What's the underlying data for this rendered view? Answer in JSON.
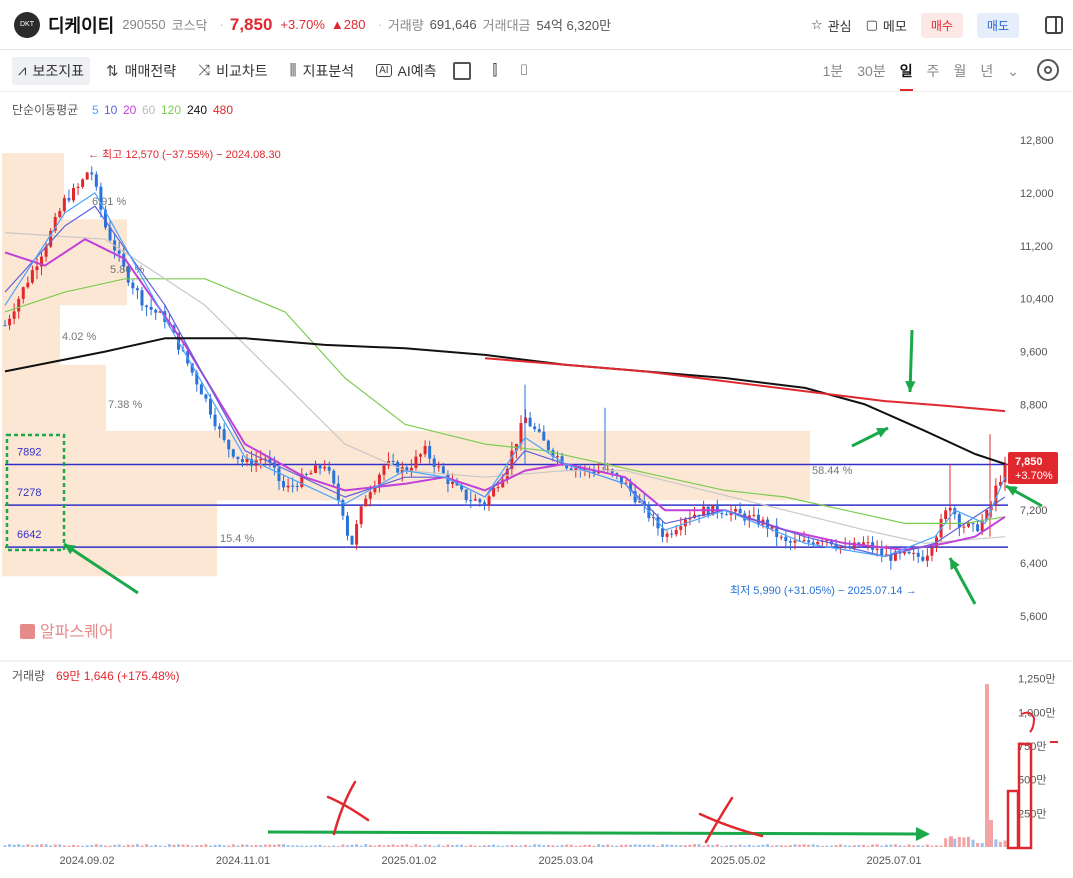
{
  "header": {
    "logo_text": "DKT",
    "name": "디케이티",
    "code": "290550",
    "market": "코스닥",
    "price": "7,850",
    "change_pct": "+3.70%",
    "change": "▲280",
    "volume_label": "거래량",
    "volume": "691,646",
    "amount_label": "거래대금",
    "amount": "54억 6,320만",
    "watch_label": "관심",
    "memo_label": "메모",
    "buy_label": "매수",
    "sell_label": "매도"
  },
  "toolbar": {
    "indicators": "보조지표",
    "strategy": "매매전략",
    "compare": "비교차트",
    "analysis": "지표분석",
    "ai_badge": "AI",
    "ai": "AI예측",
    "periods": [
      "1분",
      "30분",
      "일",
      "주",
      "월",
      "년"
    ],
    "selected_period": "일"
  },
  "chart_data": {
    "type": "candlestick",
    "ma_legend": {
      "label": "단순이동평균",
      "periods": [
        "5",
        "10",
        "20",
        "60",
        "120",
        "240",
        "480"
      ],
      "colors": [
        "#4aa3ff",
        "#6060d8",
        "#c040d8",
        "#bbbbbb",
        "#7ccc50",
        "#111111",
        "#e0282e"
      ]
    },
    "y_ticks": [
      12800,
      12000,
      11200,
      10400,
      9600,
      8800,
      7200,
      6400,
      5600
    ],
    "y_tick_labels": [
      "12,800",
      "12,000",
      "11,200",
      "10,400",
      "9,600",
      "8,800",
      "7,200",
      "6,400",
      "5,600"
    ],
    "y_range": [
      5300,
      13500
    ],
    "x_date_labels": [
      "2024.09.02",
      "2024.11.01",
      "2025.01.02",
      "2025.03.04",
      "2025.05.02",
      "2025.07.01"
    ],
    "x_date_positions": [
      0.082,
      0.238,
      0.404,
      0.561,
      0.733,
      0.889
    ],
    "high_label": "최고 12,570 (−37.55%) − 2024.08.30",
    "low_label": "최저 5,990 (+31.05%) − 2025.07.14",
    "current_price": "7,850",
    "current_change": "+3.70%",
    "levels": [
      {
        "value": 7892,
        "label": "7892",
        "color": "#3030c8"
      },
      {
        "value": 7278,
        "label": "7278",
        "color": "#3030c8"
      },
      {
        "value": 6642,
        "label": "6642",
        "color": "#3030c8"
      }
    ],
    "volume_profile_labels": [
      "6.91 %",
      "5.86 %",
      "4.02 %",
      "7.38 %",
      "58.44 %",
      "15.4 %"
    ],
    "watermark": "알파스퀘어",
    "volume_legend": {
      "label": "거래량",
      "value": "69만 1,646 (+175.48%)"
    },
    "volume_ticks": [
      "1,250만",
      "1,000만",
      "750만",
      "500만",
      "250만"
    ],
    "volume_range": [
      0,
      1300
    ],
    "price_key_points": [
      [
        0.0,
        10000
      ],
      [
        0.02,
        10600
      ],
      [
        0.04,
        11200
      ],
      [
        0.06,
        11900
      ],
      [
        0.075,
        12100
      ],
      [
        0.085,
        12400
      ],
      [
        0.1,
        11500
      ],
      [
        0.12,
        10800
      ],
      [
        0.14,
        10300
      ],
      [
        0.16,
        10100
      ],
      [
        0.18,
        9500
      ],
      [
        0.2,
        8900
      ],
      [
        0.22,
        8200
      ],
      [
        0.24,
        7900
      ],
      [
        0.26,
        8000
      ],
      [
        0.28,
        7500
      ],
      [
        0.3,
        7700
      ],
      [
        0.32,
        7900
      ],
      [
        0.34,
        7100
      ],
      [
        0.345,
        6600
      ],
      [
        0.36,
        7400
      ],
      [
        0.38,
        7900
      ],
      [
        0.4,
        7800
      ],
      [
        0.42,
        8100
      ],
      [
        0.44,
        7700
      ],
      [
        0.46,
        7400
      ],
      [
        0.48,
        7300
      ],
      [
        0.5,
        7800
      ],
      [
        0.52,
        8600
      ],
      [
        0.54,
        8200
      ],
      [
        0.56,
        7900
      ],
      [
        0.58,
        7800
      ],
      [
        0.6,
        7800
      ],
      [
        0.62,
        7600
      ],
      [
        0.64,
        7200
      ],
      [
        0.66,
        6800
      ],
      [
        0.68,
        7100
      ],
      [
        0.7,
        7200
      ],
      [
        0.72,
        7200
      ],
      [
        0.74,
        7100
      ],
      [
        0.76,
        7000
      ],
      [
        0.78,
        6700
      ],
      [
        0.8,
        6700
      ],
      [
        0.82,
        6800
      ],
      [
        0.84,
        6600
      ],
      [
        0.86,
        6700
      ],
      [
        0.88,
        6500
      ],
      [
        0.9,
        6500
      ],
      [
        0.92,
        6500
      ],
      [
        0.93,
        6800
      ],
      [
        0.945,
        7300
      ],
      [
        0.955,
        7000
      ],
      [
        0.97,
        6900
      ],
      [
        0.985,
        7200
      ],
      [
        0.99,
        7500
      ],
      [
        1.0,
        7850
      ]
    ],
    "ma5_points": [
      [
        0.0,
        10300
      ],
      [
        0.06,
        11700
      ],
      [
        0.09,
        12000
      ],
      [
        0.16,
        10100
      ],
      [
        0.24,
        8000
      ],
      [
        0.34,
        7300
      ],
      [
        0.4,
        7800
      ],
      [
        0.44,
        7700
      ],
      [
        0.48,
        7400
      ],
      [
        0.52,
        8300
      ],
      [
        0.56,
        7900
      ],
      [
        0.62,
        7600
      ],
      [
        0.66,
        6900
      ],
      [
        0.72,
        7200
      ],
      [
        0.8,
        6700
      ],
      [
        0.88,
        6500
      ],
      [
        0.93,
        6800
      ],
      [
        0.95,
        7200
      ],
      [
        0.98,
        7000
      ],
      [
        1.0,
        7700
      ]
    ],
    "ma10_points": [
      [
        0.0,
        10500
      ],
      [
        0.06,
        11500
      ],
      [
        0.09,
        11800
      ],
      [
        0.16,
        10300
      ],
      [
        0.24,
        8100
      ],
      [
        0.34,
        7400
      ],
      [
        0.4,
        7700
      ],
      [
        0.44,
        7700
      ],
      [
        0.48,
        7400
      ],
      [
        0.52,
        8100
      ],
      [
        0.56,
        7900
      ],
      [
        0.62,
        7600
      ],
      [
        0.66,
        7000
      ],
      [
        0.72,
        7200
      ],
      [
        0.8,
        6800
      ],
      [
        0.88,
        6500
      ],
      [
        0.93,
        6700
      ],
      [
        0.96,
        7000
      ],
      [
        1.0,
        7400
      ]
    ],
    "ma20_points": [
      [
        0.0,
        11100
      ],
      [
        0.04,
        10900
      ],
      [
        0.08,
        11300
      ],
      [
        0.12,
        11000
      ],
      [
        0.18,
        9700
      ],
      [
        0.24,
        8200
      ],
      [
        0.3,
        7700
      ],
      [
        0.34,
        7500
      ],
      [
        0.4,
        7600
      ],
      [
        0.44,
        7700
      ],
      [
        0.48,
        7500
      ],
      [
        0.52,
        7800
      ],
      [
        0.56,
        7900
      ],
      [
        0.62,
        7700
      ],
      [
        0.66,
        7200
      ],
      [
        0.72,
        7200
      ],
      [
        0.78,
        6900
      ],
      [
        0.84,
        6700
      ],
      [
        0.9,
        6600
      ],
      [
        0.94,
        6700
      ],
      [
        0.97,
        6800
      ],
      [
        1.0,
        7100
      ]
    ],
    "ma60_points": [
      [
        0.0,
        11400
      ],
      [
        0.1,
        11300
      ],
      [
        0.2,
        10300
      ],
      [
        0.28,
        9100
      ],
      [
        0.34,
        8200
      ],
      [
        0.4,
        7800
      ],
      [
        0.48,
        7700
      ],
      [
        0.56,
        7800
      ],
      [
        0.62,
        7800
      ],
      [
        0.7,
        7500
      ],
      [
        0.78,
        7200
      ],
      [
        0.86,
        6900
      ],
      [
        0.92,
        6700
      ],
      [
        1.0,
        6800
      ]
    ],
    "ma120_points": [
      [
        0.0,
        10200
      ],
      [
        0.06,
        10500
      ],
      [
        0.12,
        10700
      ],
      [
        0.2,
        10700
      ],
      [
        0.28,
        10200
      ],
      [
        0.34,
        9200
      ],
      [
        0.4,
        8500
      ],
      [
        0.48,
        8200
      ],
      [
        0.54,
        8100
      ],
      [
        0.6,
        7900
      ],
      [
        0.66,
        7700
      ],
      [
        0.72,
        7500
      ],
      [
        0.78,
        7400
      ],
      [
        0.84,
        7200
      ],
      [
        0.9,
        7000
      ],
      [
        0.96,
        7000
      ],
      [
        1.0,
        7100
      ]
    ],
    "ma240_points": [
      [
        0.0,
        9300
      ],
      [
        0.05,
        9450
      ],
      [
        0.1,
        9600
      ],
      [
        0.16,
        9800
      ],
      [
        0.24,
        9800
      ],
      [
        0.32,
        9700
      ],
      [
        0.4,
        9650
      ],
      [
        0.48,
        9550
      ],
      [
        0.56,
        9400
      ],
      [
        0.64,
        9300
      ],
      [
        0.72,
        9200
      ],
      [
        0.8,
        9050
      ],
      [
        0.86,
        8800
      ],
      [
        0.92,
        8400
      ],
      [
        0.97,
        8050
      ],
      [
        1.0,
        7900
      ]
    ],
    "ma480_points": [
      [
        0.48,
        9500
      ],
      [
        0.56,
        9400
      ],
      [
        0.64,
        9300
      ],
      [
        0.72,
        9150
      ],
      [
        0.8,
        9000
      ],
      [
        0.88,
        8850
      ],
      [
        0.94,
        8780
      ],
      [
        1.0,
        8700
      ]
    ]
  }
}
